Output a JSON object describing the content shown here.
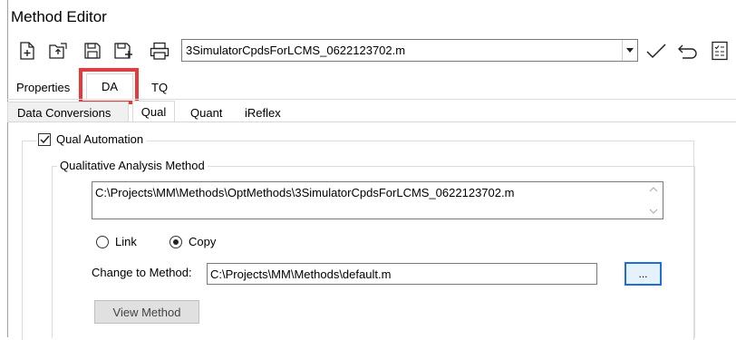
{
  "window": {
    "title": "Method Editor"
  },
  "toolbar": {
    "icons": [
      "new-document-icon",
      "open-icon",
      "save-icon",
      "save-as-icon",
      "print-icon"
    ],
    "method_file": "3SimulatorCpdsForLCMS_0622123702.m",
    "right_icons": [
      "check-icon",
      "undo-icon",
      "checklist-icon"
    ]
  },
  "tabs": {
    "properties": "Properties",
    "da": "DA",
    "tq": "TQ"
  },
  "subtabs": {
    "data_conversions": "Data Conversions",
    "qual": "Qual",
    "quant": "Quant",
    "ireflex": "iReflex"
  },
  "qual": {
    "automation_label": "Qual Automation",
    "automation_checked": true,
    "method_group_label": "Qualitative Analysis Method",
    "method_path": "C:\\Projects\\MM\\Methods\\OptMethods\\3SimulatorCpdsForLCMS_0622123702.m",
    "radio_link": "Link",
    "radio_copy": "Copy",
    "selected_radio": "Copy",
    "change_label": "Change to Method:",
    "change_value": "C:\\Projects\\MM\\Methods\\default.m",
    "browse_label": "...",
    "view_button": "View Method"
  },
  "colors": {
    "highlight": "#e8393a",
    "focus_border": "#1e6fd9"
  }
}
